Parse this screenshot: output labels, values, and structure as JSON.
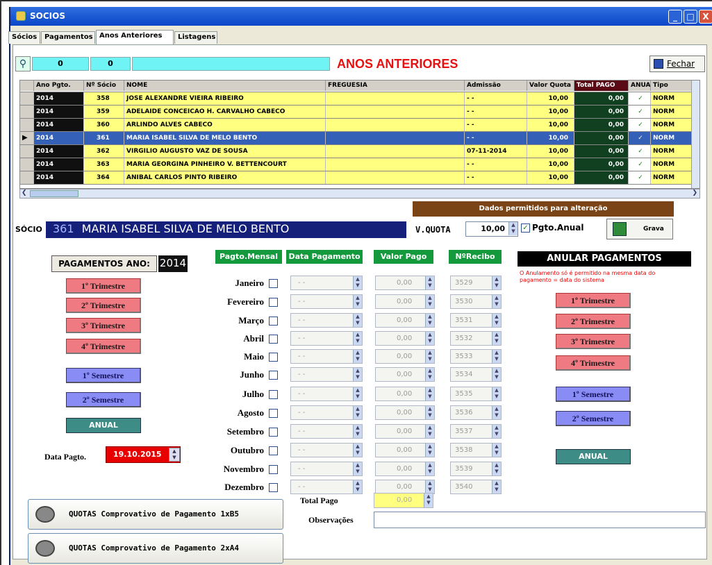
{
  "window": {
    "title": "SOCIOS",
    "min": "_",
    "max": "□",
    "close": "X"
  },
  "tabs": [
    "Sócios",
    "Pagamentos",
    "Anos Anteriores",
    "Listagens"
  ],
  "toolbar": {
    "counter1": "0",
    "counter2": "0",
    "title": "ANOS ANTERIORES",
    "close_label": "Fechar",
    "close_mnemonic": "F"
  },
  "grid": {
    "headers": [
      "Ano Pgto.",
      "Nº Sócio",
      "NOME",
      "FREGUESIA",
      "Admissão",
      "Valor Quota",
      "Total PAGO",
      "ANUAL",
      "Tipo"
    ],
    "rows": [
      {
        "ano": "2014",
        "num": "358",
        "nome": "JOSE ALEXANDRE VIEIRA RIBEIRO",
        "freg": "",
        "adm": "- -",
        "quota": "10,00",
        "total": "0,00",
        "anual": "✓",
        "tipo": "NORM"
      },
      {
        "ano": "2014",
        "num": "359",
        "nome": "ADELAIDE CONCEICAO H. CARVALHO CABECO",
        "freg": "",
        "adm": "- -",
        "quota": "10,00",
        "total": "0,00",
        "anual": "✓",
        "tipo": "NORM"
      },
      {
        "ano": "2014",
        "num": "360",
        "nome": "ARLINDO ALVES CABECO",
        "freg": "",
        "adm": "- -",
        "quota": "10,00",
        "total": "0,00",
        "anual": "✓",
        "tipo": "NORM"
      },
      {
        "ano": "2014",
        "num": "361",
        "nome": "MARIA ISABEL SILVA DE MELO BENTO",
        "freg": "",
        "adm": "- -",
        "quota": "10,00",
        "total": "0,00",
        "anual": "✓",
        "tipo": "NORM"
      },
      {
        "ano": "2014",
        "num": "362",
        "nome": "VIRGILIO AUGUSTO VAZ DE SOUSA",
        "freg": "",
        "adm": "07-11-2014",
        "quota": "10,00",
        "total": "0,00",
        "anual": "✓",
        "tipo": "NORM"
      },
      {
        "ano": "2014",
        "num": "363",
        "nome": "MARIA GEORGINA PINHEIRO V. BETTENCOURT",
        "freg": "",
        "adm": "- -",
        "quota": "10,00",
        "total": "0,00",
        "anual": "✓",
        "tipo": "NORM"
      },
      {
        "ano": "2014",
        "num": "364",
        "nome": "ANIBAL CARLOS PINTO RIBEIRO",
        "freg": "",
        "adm": "- -",
        "quota": "10,00",
        "total": "0,00",
        "anual": "✓",
        "tipo": "NORM"
      }
    ]
  },
  "edit": {
    "banner": "Dados permitidos para alteração",
    "socio_label": "SÓCIO",
    "socio_num": "361",
    "socio_name": "MARIA ISABEL SILVA DE MELO BENTO",
    "quota_label": "V.QUOTA",
    "quota_value": "10,00",
    "anual_label": "Pgto.Anual",
    "save_label": "Grava"
  },
  "left": {
    "year_label": "PAGAMENTOS ANO:",
    "year": "2014",
    "trim": [
      "1º Trimestre",
      "2º Trimestre",
      "3º Trimestre",
      "4º Trimestre"
    ],
    "sem": [
      "1º Semestre",
      "2º Semestre"
    ],
    "anual": "ANUAL",
    "date_label": "Data Pagto.",
    "date_value": "19.10.2015"
  },
  "payments": {
    "headers": [
      "Pagto.Mensal",
      "Data Pagamento",
      "Valor Pago",
      "NºRecibo"
    ],
    "months": [
      "Janeiro",
      "Fevereiro",
      "Março",
      "Abril",
      "Maio",
      "Junho",
      "Julho",
      "Agosto",
      "Setembro",
      "Outubro",
      "Novembro",
      "Dezembro"
    ],
    "date_placeholder": "- -",
    "value": "0,00",
    "receipts": [
      "3529",
      "3530",
      "3531",
      "3532",
      "3533",
      "3534",
      "3535",
      "3536",
      "3537",
      "3538",
      "3539",
      "3540"
    ],
    "total_label": "Total Pago",
    "total_value": "0,00",
    "obs_label": "Observações",
    "obs_value": ""
  },
  "anular": {
    "title": "ANULAR PAGAMENTOS",
    "note": "O Anulamento só é permitido na mesma data do pagamento = data do sistema",
    "trim": [
      "1º Trimestre",
      "2º Trimestre",
      "3º Trimestre",
      "4º Trimestre"
    ],
    "sem": [
      "1º Semestre",
      "2º Semestre"
    ],
    "anual": "ANUAL"
  },
  "reports": [
    "QUOTAS Comprovativo de Pagamento 1xB5",
    "QUOTAS Comprovativo de Pagamento 2xA4"
  ],
  "colors": {
    "yellow": "#ffff80",
    "selected": "#3560b8",
    "dark": "#101010",
    "green_total": "#104020",
    "red_title": "#e81010",
    "navy": "#15207a",
    "brown": "#7a4416"
  }
}
